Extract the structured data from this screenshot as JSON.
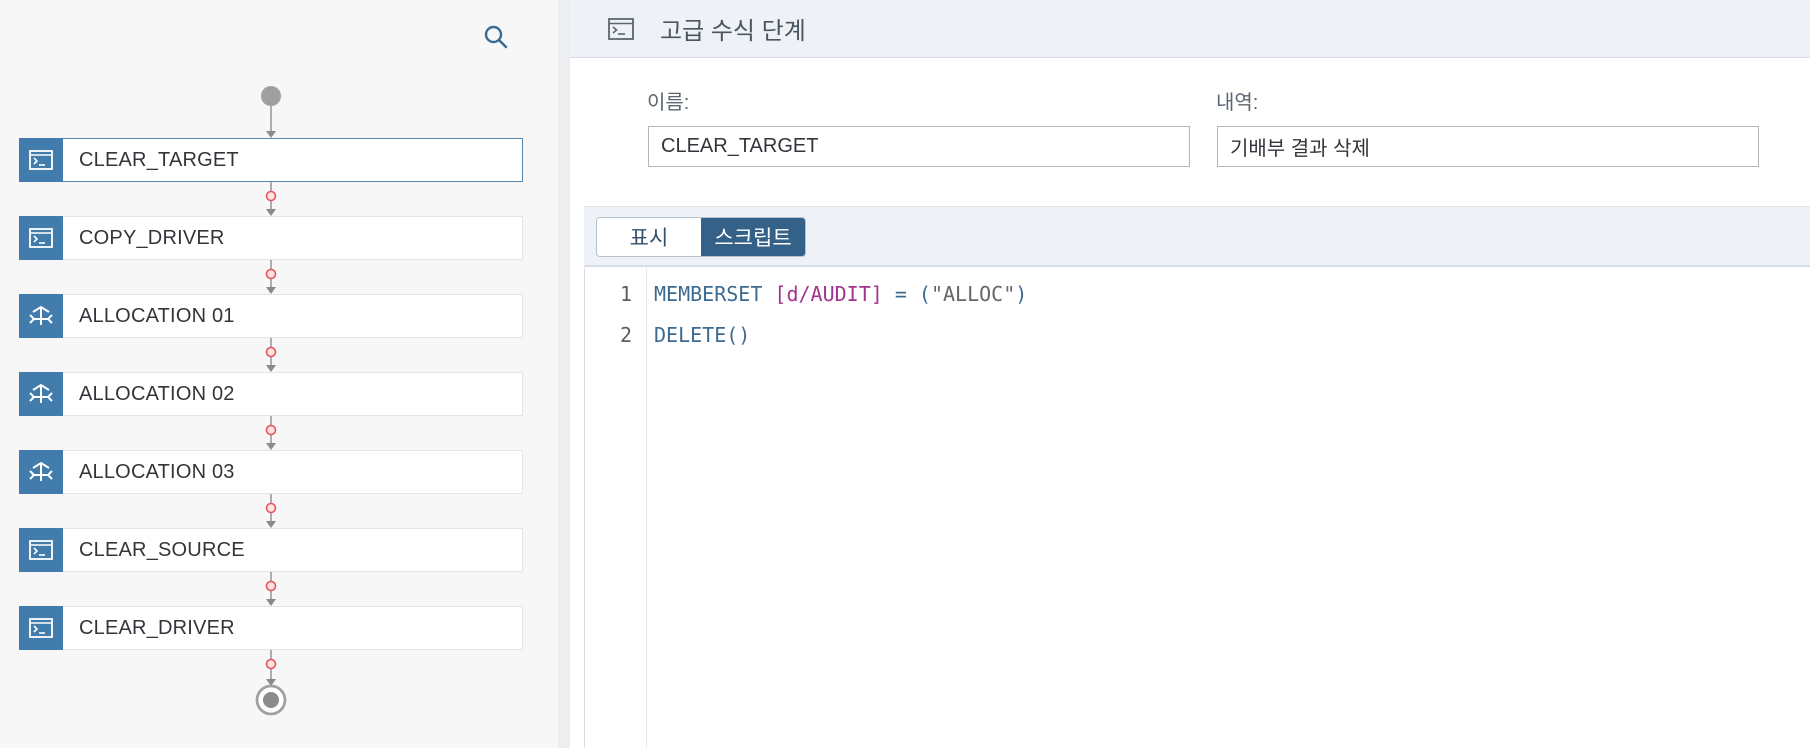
{
  "flow": {
    "steps": [
      {
        "label": "CLEAR_TARGET",
        "type": "script",
        "selected": true
      },
      {
        "label": "COPY_DRIVER",
        "type": "script",
        "selected": false
      },
      {
        "label": "ALLOCATION 01",
        "type": "allocation",
        "selected": false
      },
      {
        "label": "ALLOCATION 02",
        "type": "allocation",
        "selected": false
      },
      {
        "label": "ALLOCATION 03",
        "type": "allocation",
        "selected": false
      },
      {
        "label": "CLEAR_SOURCE",
        "type": "script",
        "selected": false
      },
      {
        "label": "CLEAR_DRIVER",
        "type": "script",
        "selected": false
      }
    ],
    "search_icon": "search-icon",
    "start_icon": "start-node",
    "end_icon": "end-node"
  },
  "header": {
    "title": "고급 수식 단계",
    "icon": "script-step-icon"
  },
  "form": {
    "name_label": "이름:",
    "name_value": "CLEAR_TARGET",
    "description_label": "내역:",
    "description_value": "기배부 결과 삭제"
  },
  "tabs": {
    "display_label": "표시",
    "script_label": "스크립트",
    "active": "스크립트"
  },
  "editor": {
    "lines": [
      {
        "number": "1",
        "keyword": "MEMBERSET",
        "dimension": "[d/AUDIT]",
        "operator": "= (",
        "string": "\"ALLOC\"",
        "close": ")"
      },
      {
        "number": "2",
        "text": "DELETE()"
      }
    ]
  },
  "colors": {
    "accent": "#427cac",
    "active_tab": "#346187",
    "connector_dot": "#e8545e",
    "dimension_token": "#a3348e"
  }
}
